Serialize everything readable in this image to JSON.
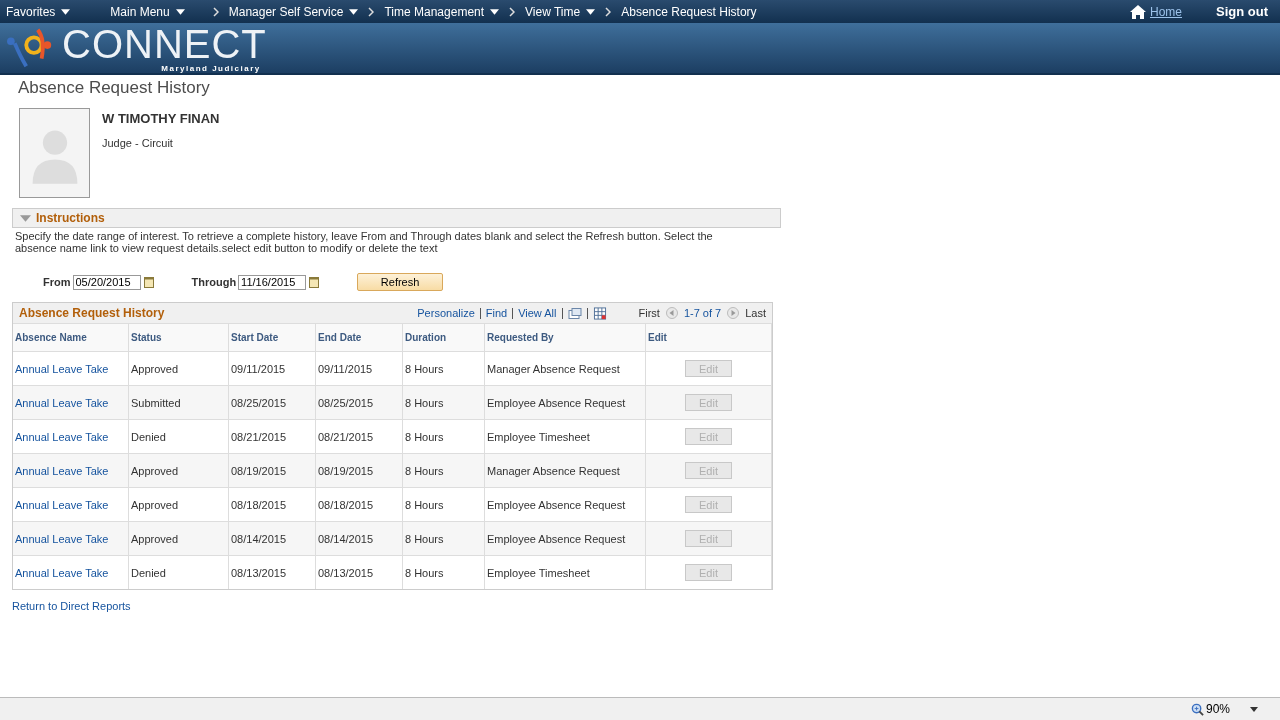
{
  "nav": {
    "items": [
      {
        "label": "Favorites"
      },
      {
        "label": "Main Menu"
      },
      {
        "label": "Manager Self Service"
      },
      {
        "label": "Time Management"
      },
      {
        "label": "View Time"
      }
    ],
    "current": "Absence Request History",
    "home": "Home",
    "signout": "Sign out"
  },
  "logo": {
    "name": "CONNECT",
    "sub": "Maryland Judiciary"
  },
  "page_title": "Absence Request History",
  "person": {
    "name": "W TIMOTHY FINAN",
    "role": "Judge - Circuit"
  },
  "instructions": {
    "title": "Instructions",
    "expanded": true,
    "text": "Specify the date range of interest. To retrieve a complete history, leave From and Through dates blank and select the Refresh button. Select the absence name link to view request details.select edit button to modify or delete the text"
  },
  "filter": {
    "from_label": "From",
    "from": "05/20/2015",
    "through_label": "Through",
    "through": "11/16/2015",
    "button": "Refresh"
  },
  "grid": {
    "title": "Absence Request History",
    "links": [
      "Personalize",
      "Find",
      "View All"
    ],
    "first": "First",
    "range": "1-7 of 7",
    "last": "Last",
    "columns": [
      "Absence Name",
      "Status",
      "Start Date",
      "End Date",
      "Duration",
      "Requested By",
      "Edit"
    ],
    "rows": [
      {
        "name": "Annual Leave Take",
        "status": "Approved",
        "start": "09/11/2015",
        "end": "09/11/2015",
        "duration": "8 Hours",
        "by": "Manager Absence Request",
        "edit": "Edit",
        "disabled": true
      },
      {
        "name": "Annual Leave Take",
        "status": "Submitted",
        "start": "08/25/2015",
        "end": "08/25/2015",
        "duration": "8 Hours",
        "by": "Employee Absence Request",
        "edit": "Edit",
        "disabled": true
      },
      {
        "name": "Annual Leave Take",
        "status": "Denied",
        "start": "08/21/2015",
        "end": "08/21/2015",
        "duration": "8 Hours",
        "by": "Employee Timesheet",
        "edit": "Edit",
        "disabled": true
      },
      {
        "name": "Annual Leave Take",
        "status": "Approved",
        "start": "08/19/2015",
        "end": "08/19/2015",
        "duration": "8 Hours",
        "by": "Manager Absence Request",
        "edit": "Edit",
        "disabled": true
      },
      {
        "name": "Annual Leave Take",
        "status": "Approved",
        "start": "08/18/2015",
        "end": "08/18/2015",
        "duration": "8 Hours",
        "by": "Employee Absence Request",
        "edit": "Edit",
        "disabled": true
      },
      {
        "name": "Annual Leave Take",
        "status": "Approved",
        "start": "08/14/2015",
        "end": "08/14/2015",
        "duration": "8 Hours",
        "by": "Employee Absence Request",
        "edit": "Edit",
        "disabled": true
      },
      {
        "name": "Annual Leave Take",
        "status": "Denied",
        "start": "08/13/2015",
        "end": "08/13/2015",
        "duration": "8 Hours",
        "by": "Employee Timesheet",
        "edit": "Edit",
        "disabled": true
      }
    ]
  },
  "return_link": "Return to Direct Reports",
  "status_bar": {
    "zoom": "90%"
  }
}
